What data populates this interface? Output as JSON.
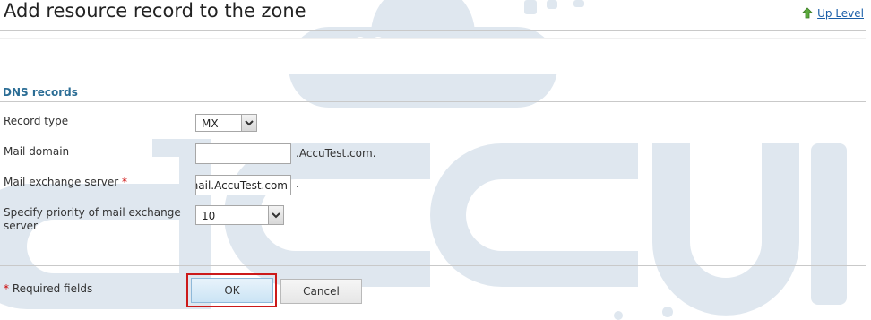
{
  "page": {
    "title": "Add resource record to the zone",
    "up_level": "Up Level"
  },
  "section": {
    "title": "DNS records"
  },
  "form": {
    "record_type": {
      "label": "Record type",
      "value": "MX"
    },
    "mail_domain": {
      "label": "Mail domain",
      "value": "",
      "suffix": ".AccuTest.com."
    },
    "mail_exchange_server": {
      "label": "Mail exchange server",
      "required_mark": "*",
      "value": "mail.AccuTest.com",
      "suffix": "."
    },
    "priority": {
      "label_line1": "Specify priority of mail exchange",
      "label_line2": "server",
      "value": "10"
    }
  },
  "footer": {
    "required_mark": "*",
    "required_note": "Required fields",
    "ok_label": "OK",
    "cancel_label": "Cancel"
  },
  "colors": {
    "section_title": "#2b6d95",
    "link": "#1a5ea8",
    "required": "#cc0000",
    "highlight_box": "#cc1a1a",
    "watermark": "#dfe7ef"
  },
  "icons": [
    "up-arrow-icon",
    "chevron-down-icon"
  ]
}
